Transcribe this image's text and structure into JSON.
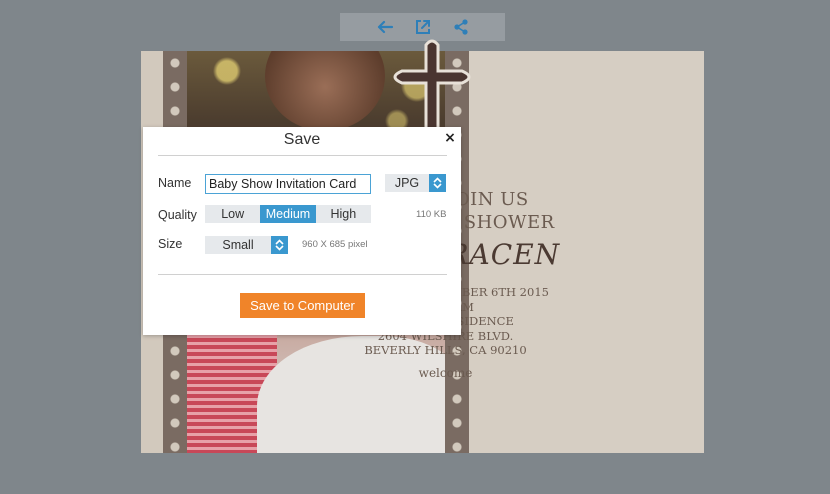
{
  "toolbar": {
    "icons": [
      "back-arrow-icon",
      "open-external-icon",
      "share-icon"
    ],
    "icon_color": "#2e7fb8"
  },
  "invitation": {
    "line1": "PLEASE JOIN US",
    "line2": "FOR A BABY SHOWER",
    "name": "ABBY GRACEN",
    "details": [
      "SATURDAY, NOVEMBER 6TH 2015",
      "11:00 AM",
      "ROCUCCI RESIDENCE",
      "2604 WILSHIRE BLVD.",
      "BEVERLY HILLS, CA 90210"
    ],
    "welcome": "welcome"
  },
  "dialog": {
    "title": "Save",
    "close_label": "×",
    "name_label": "Name",
    "name_value": "Baby Show Invitation Card",
    "format_value": "JPG",
    "quality_label": "Quality",
    "quality_options": [
      "Low",
      "Medium",
      "High"
    ],
    "quality_selected": "Medium",
    "file_size": "110 KB",
    "size_label": "Size",
    "size_value": "Small",
    "dimensions": "960 X 685 pixel",
    "save_button": "Save to Computer"
  },
  "colors": {
    "accent_blue": "#3a98cf",
    "save_orange": "#f08429",
    "backdrop": "#7f868b"
  }
}
